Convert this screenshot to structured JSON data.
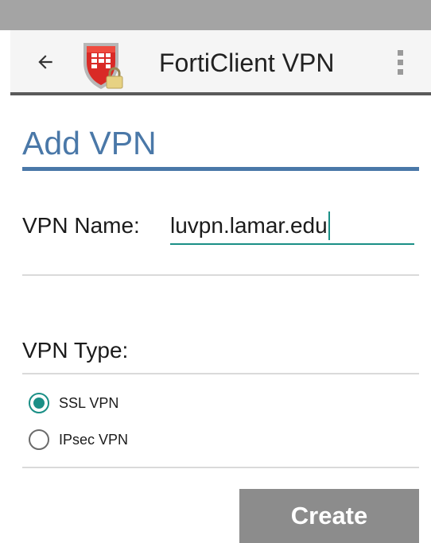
{
  "app_bar": {
    "title": "FortiClient VPN",
    "back_icon": "arrow-left-icon",
    "logo_icon": "forticlient-shield-lock-icon",
    "menu_icon": "overflow-menu-icon"
  },
  "page": {
    "title": "Add VPN"
  },
  "vpn_name": {
    "label": "VPN Name:",
    "value": "luvpn.lamar.edu",
    "focused": true
  },
  "vpn_type": {
    "label": "VPN Type:",
    "options": [
      {
        "label": "SSL VPN",
        "selected": true
      },
      {
        "label": "IPsec VPN",
        "selected": false
      }
    ]
  },
  "actions": {
    "create_label": "Create"
  },
  "colors": {
    "accent": "#1a8f86",
    "title_blue": "#4a78a8",
    "status_bar": "#a4a4a4",
    "button_gray": "#8c8c8c",
    "logo_red": "#d92a26"
  }
}
